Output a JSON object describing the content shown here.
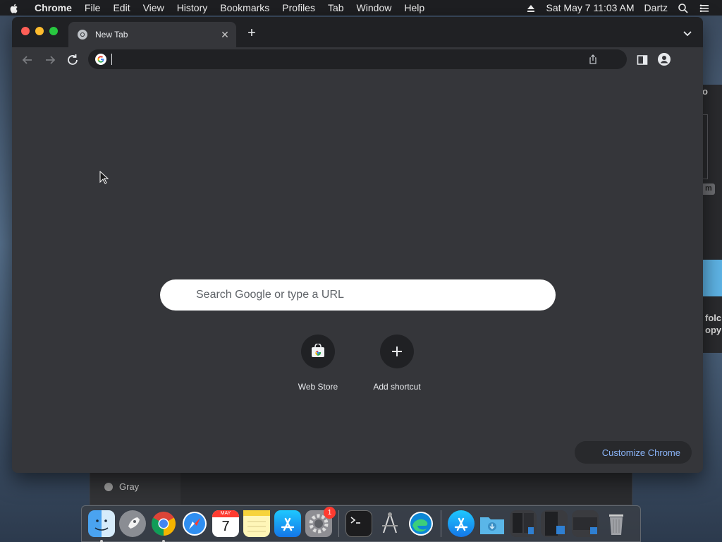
{
  "menubar": {
    "app_name": "Chrome",
    "items": [
      "File",
      "Edit",
      "View",
      "History",
      "Bookmarks",
      "Profiles",
      "Tab",
      "Window",
      "Help"
    ],
    "clock": "Sat May 7  11:03 AM",
    "user": "Dartz"
  },
  "background_window": {
    "right_texts": [
      "o",
      "m",
      "folc",
      "opy"
    ],
    "sidebar_item": "Gray"
  },
  "browser": {
    "tab": {
      "title": "New Tab"
    },
    "omnibox": {
      "value": "",
      "placeholder": ""
    },
    "newtab_page": {
      "search_placeholder": "Search Google or type a URL",
      "shortcuts": [
        {
          "label": "Web Store",
          "icon": "web-store-icon"
        },
        {
          "label": "Add shortcut",
          "icon": "plus-icon"
        }
      ],
      "customize_label": "Customize Chrome"
    }
  },
  "dock": {
    "apps": [
      "Finder",
      "Launchpad",
      "Google Chrome",
      "Safari",
      "Calendar",
      "Notes",
      "App Store",
      "System Preferences",
      "Terminal",
      "Script Editor",
      "Microsoft Edge",
      "App Store",
      "Downloads",
      "Documents",
      "Desktop",
      "Screenshot",
      "Trash"
    ],
    "calendar_month": "MAY",
    "calendar_day": "7",
    "system_prefs_badge": "1"
  },
  "colors": {
    "accent": "#8ab4f8",
    "chrome_bg": "#35363a",
    "tabstrip_bg": "#202124"
  }
}
